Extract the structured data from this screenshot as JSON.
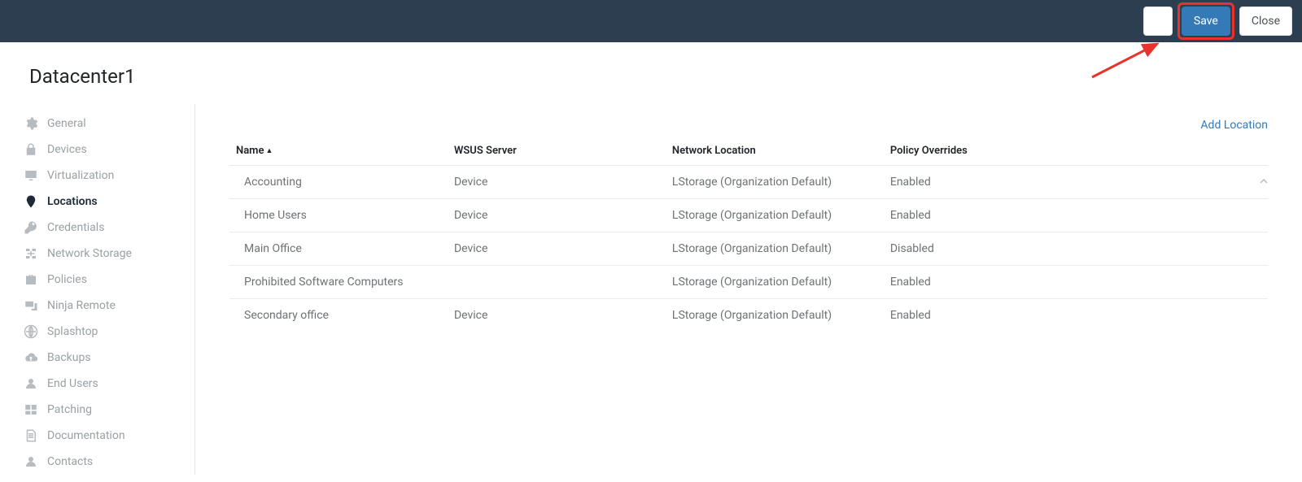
{
  "header": {
    "help_tooltip": "Help",
    "save_label": "Save",
    "close_label": "Close"
  },
  "page_title": "Datacenter1",
  "sidebar": {
    "items": [
      {
        "label": "General",
        "icon": "gear-icon",
        "active": false
      },
      {
        "label": "Devices",
        "icon": "lock-icon",
        "active": false
      },
      {
        "label": "Virtualization",
        "icon": "monitor-icon",
        "active": false
      },
      {
        "label": "Locations",
        "icon": "pin-icon",
        "active": true
      },
      {
        "label": "Credentials",
        "icon": "key-icon",
        "active": false
      },
      {
        "label": "Network Storage",
        "icon": "network-icon",
        "active": false
      },
      {
        "label": "Policies",
        "icon": "briefcase-icon",
        "active": false
      },
      {
        "label": "Ninja Remote",
        "icon": "remote-icon",
        "active": false
      },
      {
        "label": "Splashtop",
        "icon": "globe-icon",
        "active": false
      },
      {
        "label": "Backups",
        "icon": "cloud-up-icon",
        "active": false
      },
      {
        "label": "End Users",
        "icon": "person-icon",
        "active": false
      },
      {
        "label": "Patching",
        "icon": "windows-icon",
        "active": false
      },
      {
        "label": "Documentation",
        "icon": "doc-icon",
        "active": false
      },
      {
        "label": "Contacts",
        "icon": "person-icon",
        "active": false
      }
    ]
  },
  "content": {
    "add_location_label": "Add Location",
    "columns": [
      "Name",
      "WSUS Server",
      "Network Location",
      "Policy Overrides"
    ],
    "sort_column": "Name",
    "sort_dir": "asc",
    "rows": [
      {
        "name": "Accounting",
        "wsus": "Device",
        "net": "LStorage (Organization Default)",
        "policy": "Enabled"
      },
      {
        "name": "Home Users",
        "wsus": "Device",
        "net": "LStorage (Organization Default)",
        "policy": "Enabled"
      },
      {
        "name": "Main Office",
        "wsus": "Device",
        "net": "LStorage (Organization Default)",
        "policy": "Disabled"
      },
      {
        "name": "Prohibited Software Computers",
        "wsus": "",
        "net": "LStorage (Organization Default)",
        "policy": "Enabled"
      },
      {
        "name": "Secondary office",
        "wsus": "Device",
        "net": "LStorage (Organization Default)",
        "policy": "Enabled"
      }
    ]
  },
  "annotation": {
    "highlight_target": "save-button",
    "arrow_color": "#e8332c"
  }
}
